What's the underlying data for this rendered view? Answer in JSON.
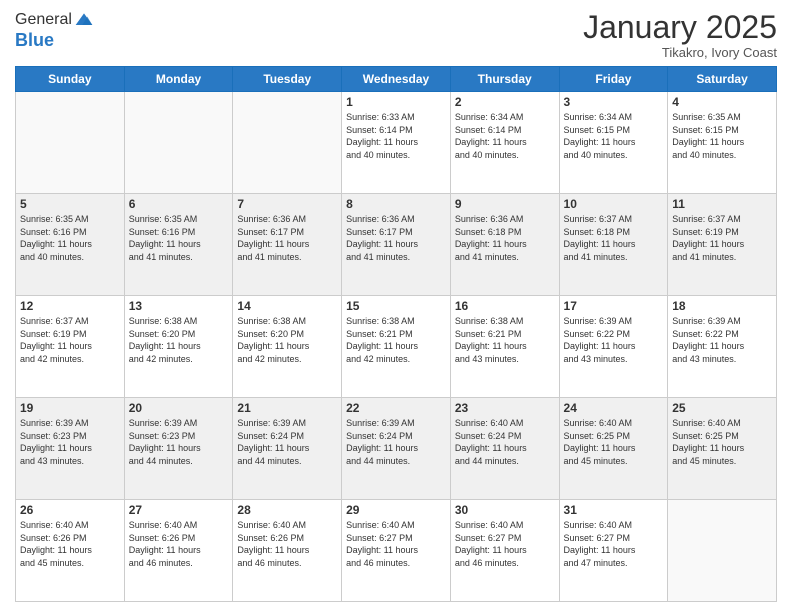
{
  "header": {
    "logo_general": "General",
    "logo_blue": "Blue",
    "month": "January 2025",
    "location": "Tikakro, Ivory Coast"
  },
  "days_of_week": [
    "Sunday",
    "Monday",
    "Tuesday",
    "Wednesday",
    "Thursday",
    "Friday",
    "Saturday"
  ],
  "weeks": [
    [
      {
        "day": "",
        "info": ""
      },
      {
        "day": "",
        "info": ""
      },
      {
        "day": "",
        "info": ""
      },
      {
        "day": "1",
        "info": "Sunrise: 6:33 AM\nSunset: 6:14 PM\nDaylight: 11 hours\nand 40 minutes."
      },
      {
        "day": "2",
        "info": "Sunrise: 6:34 AM\nSunset: 6:14 PM\nDaylight: 11 hours\nand 40 minutes."
      },
      {
        "day": "3",
        "info": "Sunrise: 6:34 AM\nSunset: 6:15 PM\nDaylight: 11 hours\nand 40 minutes."
      },
      {
        "day": "4",
        "info": "Sunrise: 6:35 AM\nSunset: 6:15 PM\nDaylight: 11 hours\nand 40 minutes."
      }
    ],
    [
      {
        "day": "5",
        "info": "Sunrise: 6:35 AM\nSunset: 6:16 PM\nDaylight: 11 hours\nand 40 minutes."
      },
      {
        "day": "6",
        "info": "Sunrise: 6:35 AM\nSunset: 6:16 PM\nDaylight: 11 hours\nand 41 minutes."
      },
      {
        "day": "7",
        "info": "Sunrise: 6:36 AM\nSunset: 6:17 PM\nDaylight: 11 hours\nand 41 minutes."
      },
      {
        "day": "8",
        "info": "Sunrise: 6:36 AM\nSunset: 6:17 PM\nDaylight: 11 hours\nand 41 minutes."
      },
      {
        "day": "9",
        "info": "Sunrise: 6:36 AM\nSunset: 6:18 PM\nDaylight: 11 hours\nand 41 minutes."
      },
      {
        "day": "10",
        "info": "Sunrise: 6:37 AM\nSunset: 6:18 PM\nDaylight: 11 hours\nand 41 minutes."
      },
      {
        "day": "11",
        "info": "Sunrise: 6:37 AM\nSunset: 6:19 PM\nDaylight: 11 hours\nand 41 minutes."
      }
    ],
    [
      {
        "day": "12",
        "info": "Sunrise: 6:37 AM\nSunset: 6:19 PM\nDaylight: 11 hours\nand 42 minutes."
      },
      {
        "day": "13",
        "info": "Sunrise: 6:38 AM\nSunset: 6:20 PM\nDaylight: 11 hours\nand 42 minutes."
      },
      {
        "day": "14",
        "info": "Sunrise: 6:38 AM\nSunset: 6:20 PM\nDaylight: 11 hours\nand 42 minutes."
      },
      {
        "day": "15",
        "info": "Sunrise: 6:38 AM\nSunset: 6:21 PM\nDaylight: 11 hours\nand 42 minutes."
      },
      {
        "day": "16",
        "info": "Sunrise: 6:38 AM\nSunset: 6:21 PM\nDaylight: 11 hours\nand 43 minutes."
      },
      {
        "day": "17",
        "info": "Sunrise: 6:39 AM\nSunset: 6:22 PM\nDaylight: 11 hours\nand 43 minutes."
      },
      {
        "day": "18",
        "info": "Sunrise: 6:39 AM\nSunset: 6:22 PM\nDaylight: 11 hours\nand 43 minutes."
      }
    ],
    [
      {
        "day": "19",
        "info": "Sunrise: 6:39 AM\nSunset: 6:23 PM\nDaylight: 11 hours\nand 43 minutes."
      },
      {
        "day": "20",
        "info": "Sunrise: 6:39 AM\nSunset: 6:23 PM\nDaylight: 11 hours\nand 44 minutes."
      },
      {
        "day": "21",
        "info": "Sunrise: 6:39 AM\nSunset: 6:24 PM\nDaylight: 11 hours\nand 44 minutes."
      },
      {
        "day": "22",
        "info": "Sunrise: 6:39 AM\nSunset: 6:24 PM\nDaylight: 11 hours\nand 44 minutes."
      },
      {
        "day": "23",
        "info": "Sunrise: 6:40 AM\nSunset: 6:24 PM\nDaylight: 11 hours\nand 44 minutes."
      },
      {
        "day": "24",
        "info": "Sunrise: 6:40 AM\nSunset: 6:25 PM\nDaylight: 11 hours\nand 45 minutes."
      },
      {
        "day": "25",
        "info": "Sunrise: 6:40 AM\nSunset: 6:25 PM\nDaylight: 11 hours\nand 45 minutes."
      }
    ],
    [
      {
        "day": "26",
        "info": "Sunrise: 6:40 AM\nSunset: 6:26 PM\nDaylight: 11 hours\nand 45 minutes."
      },
      {
        "day": "27",
        "info": "Sunrise: 6:40 AM\nSunset: 6:26 PM\nDaylight: 11 hours\nand 46 minutes."
      },
      {
        "day": "28",
        "info": "Sunrise: 6:40 AM\nSunset: 6:26 PM\nDaylight: 11 hours\nand 46 minutes."
      },
      {
        "day": "29",
        "info": "Sunrise: 6:40 AM\nSunset: 6:27 PM\nDaylight: 11 hours\nand 46 minutes."
      },
      {
        "day": "30",
        "info": "Sunrise: 6:40 AM\nSunset: 6:27 PM\nDaylight: 11 hours\nand 46 minutes."
      },
      {
        "day": "31",
        "info": "Sunrise: 6:40 AM\nSunset: 6:27 PM\nDaylight: 11 hours\nand 47 minutes."
      },
      {
        "day": "",
        "info": ""
      }
    ]
  ]
}
